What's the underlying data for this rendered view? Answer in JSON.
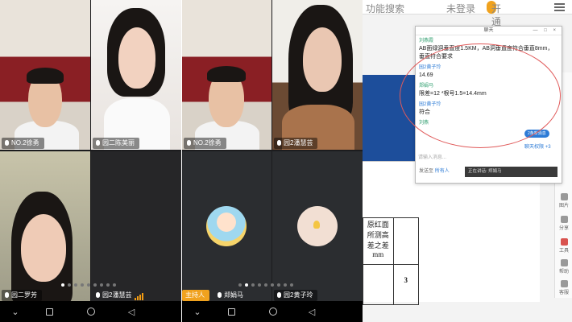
{
  "tiles": {
    "t1_name": "NO.2徐勇",
    "t2_name": "园二陈美丽",
    "t3_name": "NO.2徐勇",
    "t4_name": "园2潘慧芸",
    "t5_name": "园二罗芳",
    "t6_name": "园2潘慧芸",
    "t7_host": "主持人",
    "t7_name": "郑娟马",
    "t8_name": "园2黄子玲"
  },
  "desktop": {
    "search": "功能搜索",
    "login": "未登录",
    "vip": "开通会员"
  },
  "chat": {
    "title": "聊天",
    "winbtns": "— □ ×",
    "messages": [
      {
        "sender": "刘燕霞",
        "text": "AB面绿洞垂直度1.5KM，AB洞垂直度符合垂直8mm，垂直符合要求"
      },
      {
        "sender": "园2黄子玲",
        "text": "14.69"
      },
      {
        "sender": "郑娟马",
        "text": "限差=12 *根号1.5=14.4mm"
      },
      {
        "sender": "园2黄子玲",
        "text": "符合"
      },
      {
        "sender": "刘燕",
        "text": ""
      }
    ],
    "send_to_label": "发送至",
    "send_to_value": "所有人",
    "pill": "2条新消息",
    "fav": "聊天权限",
    "fav_count": "+3",
    "placeholder": "请输入消息...",
    "notice": "正在讲话: 郑娟马"
  },
  "table": {
    "header": "原红面所测高差之差",
    "unit": "mm",
    "value": "3"
  },
  "sidebar": [
    "图片",
    "分享",
    "工具",
    "帮助",
    "客服"
  ]
}
